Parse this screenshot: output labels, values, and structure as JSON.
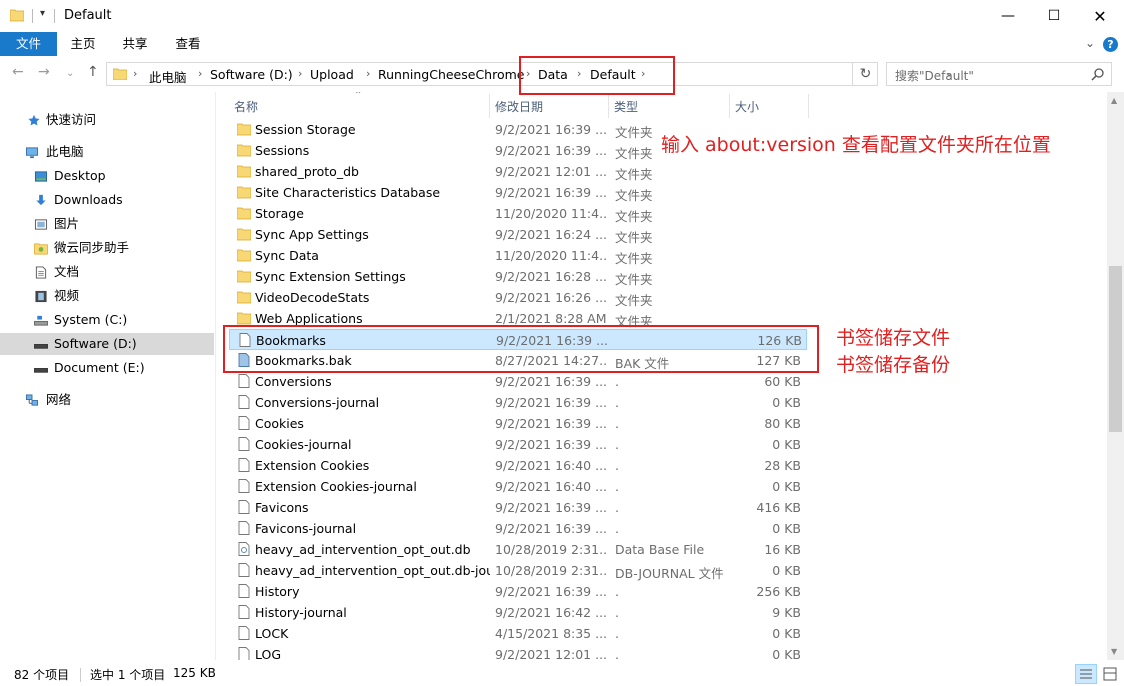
{
  "window": {
    "title": "Default"
  },
  "ribbon": {
    "tabs": [
      "文件",
      "主页",
      "共享",
      "查看"
    ]
  },
  "address": {
    "crumbs": [
      "此电脑",
      "Software (D:)",
      "Upload",
      "RunningCheeseChrome",
      "Data",
      "Default"
    ],
    "search_placeholder": "搜索\"Default\""
  },
  "sidebar": {
    "items": [
      {
        "label": "快速访问",
        "icon": "star-icon"
      },
      {
        "label": "此电脑",
        "icon": "computer-icon"
      },
      {
        "label": "Desktop",
        "icon": "desktop-icon"
      },
      {
        "label": "Downloads",
        "icon": "download-icon"
      },
      {
        "label": "图片",
        "icon": "pictures-icon"
      },
      {
        "label": "微云同步助手",
        "icon": "cloud-folder-icon"
      },
      {
        "label": "文档",
        "icon": "documents-icon"
      },
      {
        "label": "视频",
        "icon": "video-icon"
      },
      {
        "label": "System (C:)",
        "icon": "drive-icon"
      },
      {
        "label": "Software (D:)",
        "icon": "drive-icon",
        "selected": true
      },
      {
        "label": "Document (E:)",
        "icon": "drive-icon"
      },
      {
        "label": "网络",
        "icon": "network-icon"
      }
    ]
  },
  "columns": {
    "name": "名称",
    "date": "修改日期",
    "type": "类型",
    "size": "大小"
  },
  "files": [
    {
      "name": "Session Storage",
      "date": "9/2/2021 16:39 ...",
      "type": "文件夹",
      "size": "",
      "kind": "folder"
    },
    {
      "name": "Sessions",
      "date": "9/2/2021 16:39 ...",
      "type": "文件夹",
      "size": "",
      "kind": "folder"
    },
    {
      "name": "shared_proto_db",
      "date": "9/2/2021 12:01 ...",
      "type": "文件夹",
      "size": "",
      "kind": "folder"
    },
    {
      "name": "Site Characteristics Database",
      "date": "9/2/2021 16:39 ...",
      "type": "文件夹",
      "size": "",
      "kind": "folder"
    },
    {
      "name": "Storage",
      "date": "11/20/2020 11:4...",
      "type": "文件夹",
      "size": "",
      "kind": "folder"
    },
    {
      "name": "Sync App Settings",
      "date": "9/2/2021 16:24 ...",
      "type": "文件夹",
      "size": "",
      "kind": "folder"
    },
    {
      "name": "Sync Data",
      "date": "11/20/2020 11:4...",
      "type": "文件夹",
      "size": "",
      "kind": "folder"
    },
    {
      "name": "Sync Extension Settings",
      "date": "9/2/2021 16:28 ...",
      "type": "文件夹",
      "size": "",
      "kind": "folder"
    },
    {
      "name": "VideoDecodeStats",
      "date": "9/2/2021 16:26 ...",
      "type": "文件夹",
      "size": "",
      "kind": "folder"
    },
    {
      "name": "Web Applications",
      "date": "2/1/2021 8:28 AM",
      "type": "文件夹",
      "size": "",
      "kind": "folder"
    },
    {
      "name": "Bookmarks",
      "date": "9/2/2021 16:39 ...",
      "type": "",
      "size": "126 KB",
      "kind": "file",
      "selected": true
    },
    {
      "name": "Bookmarks.bak",
      "date": "8/27/2021 14:27...",
      "type": "BAK 文件",
      "size": "127 KB",
      "kind": "bak"
    },
    {
      "name": "Conversions",
      "date": "9/2/2021 16:39 ...",
      "type": ".",
      "size": "60 KB",
      "kind": "file"
    },
    {
      "name": "Conversions-journal",
      "date": "9/2/2021 16:39 ...",
      "type": ".",
      "size": "0 KB",
      "kind": "file"
    },
    {
      "name": "Cookies",
      "date": "9/2/2021 16:39 ...",
      "type": ".",
      "size": "80 KB",
      "kind": "file"
    },
    {
      "name": "Cookies-journal",
      "date": "9/2/2021 16:39 ...",
      "type": ".",
      "size": "0 KB",
      "kind": "file"
    },
    {
      "name": "Extension Cookies",
      "date": "9/2/2021 16:40 ...",
      "type": ".",
      "size": "28 KB",
      "kind": "file"
    },
    {
      "name": "Extension Cookies-journal",
      "date": "9/2/2021 16:40 ...",
      "type": ".",
      "size": "0 KB",
      "kind": "file"
    },
    {
      "name": "Favicons",
      "date": "9/2/2021 16:39 ...",
      "type": ".",
      "size": "416 KB",
      "kind": "file"
    },
    {
      "name": "Favicons-journal",
      "date": "9/2/2021 16:39 ...",
      "type": ".",
      "size": "0 KB",
      "kind": "file"
    },
    {
      "name": "heavy_ad_intervention_opt_out.db",
      "date": "10/28/2019 2:31...",
      "type": "Data Base File",
      "size": "16 KB",
      "kind": "db"
    },
    {
      "name": "heavy_ad_intervention_opt_out.db-jou...",
      "date": "10/28/2019 2:31...",
      "type": "DB-JOURNAL 文件",
      "size": "0 KB",
      "kind": "file"
    },
    {
      "name": "History",
      "date": "9/2/2021 16:39 ...",
      "type": ".",
      "size": "256 KB",
      "kind": "file"
    },
    {
      "name": "History-journal",
      "date": "9/2/2021 16:42 ...",
      "type": ".",
      "size": "9 KB",
      "kind": "file"
    },
    {
      "name": "LOCK",
      "date": "4/15/2021 8:35 ...",
      "type": ".",
      "size": "0 KB",
      "kind": "file"
    },
    {
      "name": "LOG",
      "date": "9/2/2021 12:01 ...",
      "type": ".",
      "size": "0 KB",
      "kind": "file"
    }
  ],
  "status": {
    "count": "82 个项目",
    "selection": "选中 1 个项目",
    "size": "125 KB"
  },
  "annotations": {
    "config_hint": "输入 about:version 查看配置文件夹所在位置",
    "bookmarks_file": "书签储存文件",
    "bookmarks_backup": "书签储存备份"
  },
  "colors": {
    "accent": "#1979ca",
    "annotation": "#e02020",
    "selection": "#cce8ff"
  }
}
